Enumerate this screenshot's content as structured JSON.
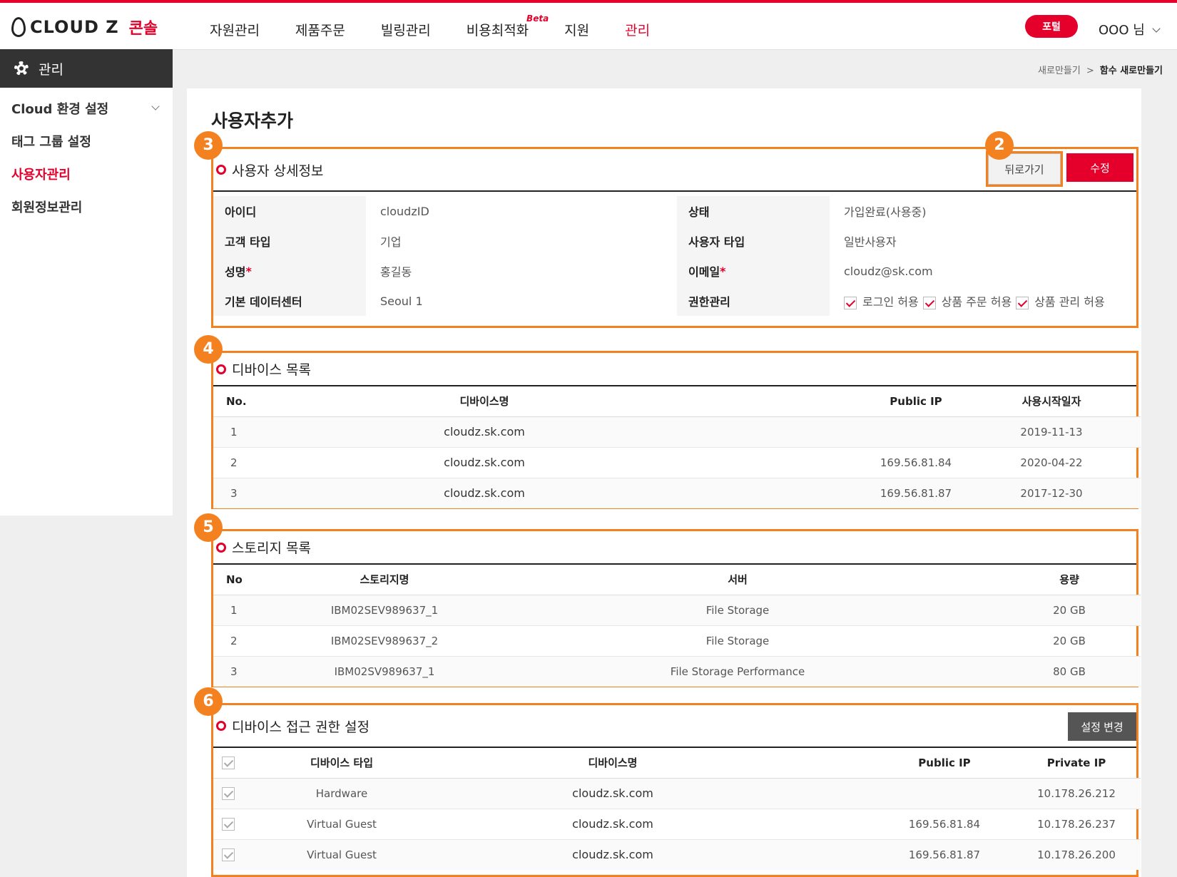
{
  "header": {
    "logo_text": "CLOUD Z",
    "logo_sub": "콘솔",
    "nav": [
      {
        "label": "자원관리"
      },
      {
        "label": "제품주문"
      },
      {
        "label": "빌링관리"
      },
      {
        "label": "비용최적화",
        "badge": "Beta"
      },
      {
        "label": "지원"
      },
      {
        "label": "관리",
        "active": true
      }
    ],
    "portal_label": "포털",
    "user_label": "OOO 님"
  },
  "sidebar": {
    "title": "관리",
    "items": [
      {
        "label": "Cloud 환경 설정",
        "expandable": true
      },
      {
        "label": "태그 그룹 설정"
      },
      {
        "label": "사용자관리",
        "active": true
      },
      {
        "label": "회원정보관리"
      }
    ]
  },
  "breadcrumb": {
    "parent": "새로만들기",
    "separator": ">",
    "current": "함수 새로만들기"
  },
  "page_title": "사용자추가",
  "annotations": {
    "detail": "3",
    "back": "2",
    "devices": "4",
    "storage": "5",
    "access": "6"
  },
  "user_detail": {
    "title": "사용자 상세정보",
    "back_label": "뒤로가기",
    "edit_label": "수정",
    "fields": {
      "id_label": "아이디",
      "id_value": "cloudzID",
      "status_label": "상태",
      "status_value": "가입완료(사용중)",
      "customer_type_label": "고객 타입",
      "customer_type_value": "기업",
      "user_type_label": "사용자 타입",
      "user_type_value": "일반사용자",
      "name_label": "성명",
      "name_value": "홍길동",
      "email_label": "이메일",
      "email_value": "cloudz@sk.com",
      "datacenter_label": "기본 데이터센터",
      "datacenter_value": "Seoul 1",
      "permission_label": "권한관리",
      "required_mark": "*"
    },
    "permissions": [
      {
        "label": "로그인 허용",
        "checked": true
      },
      {
        "label": "상품 주문 허용",
        "checked": true
      },
      {
        "label": "상품 관리 허용",
        "checked": true
      }
    ]
  },
  "devices": {
    "title": "디바이스 목록",
    "columns": [
      "No.",
      "디바이스명",
      "Public IP",
      "사용시작일자"
    ],
    "rows": [
      {
        "no": "1",
        "name": "cloudz.sk.com",
        "ip": "",
        "date": "2019-11-13"
      },
      {
        "no": "2",
        "name": "cloudz.sk.com",
        "ip": "169.56.81.84",
        "date": "2020-04-22"
      },
      {
        "no": "3",
        "name": "cloudz.sk.com",
        "ip": "169.56.81.87",
        "date": "2017-12-30"
      }
    ]
  },
  "storage": {
    "title": "스토리지 목록",
    "columns": [
      "No",
      "스토리지명",
      "서버",
      "용량"
    ],
    "rows": [
      {
        "no": "1",
        "name": "IBM02SEV989637_1",
        "server": "File Storage",
        "size": "20 GB"
      },
      {
        "no": "2",
        "name": "IBM02SEV989637_2",
        "server": "File Storage",
        "size": "20 GB"
      },
      {
        "no": "3",
        "name": "IBM02SV989637_1",
        "server": "File Storage Performance",
        "size": "80 GB"
      }
    ]
  },
  "access": {
    "title": "디바이스 접근 권한 설정",
    "change_label": "설정 변경",
    "columns": [
      "디바이스 타입",
      "디바이스명",
      "Public IP",
      "Private IP"
    ],
    "rows": [
      {
        "type": "Hardware",
        "name": "cloudz.sk.com",
        "public_ip": "",
        "private_ip": "10.178.26.212"
      },
      {
        "type": "Virtual Guest",
        "name": "cloudz.sk.com",
        "public_ip": "169.56.81.84",
        "private_ip": "10.178.26.237"
      },
      {
        "type": "Virtual Guest",
        "name": "cloudz.sk.com",
        "public_ip": "169.56.81.87",
        "private_ip": "10.178.26.200"
      }
    ]
  },
  "colors": {
    "brand_red": "#e4002b",
    "annotation_orange": "#f48120",
    "sidebar_dark": "#333333"
  }
}
